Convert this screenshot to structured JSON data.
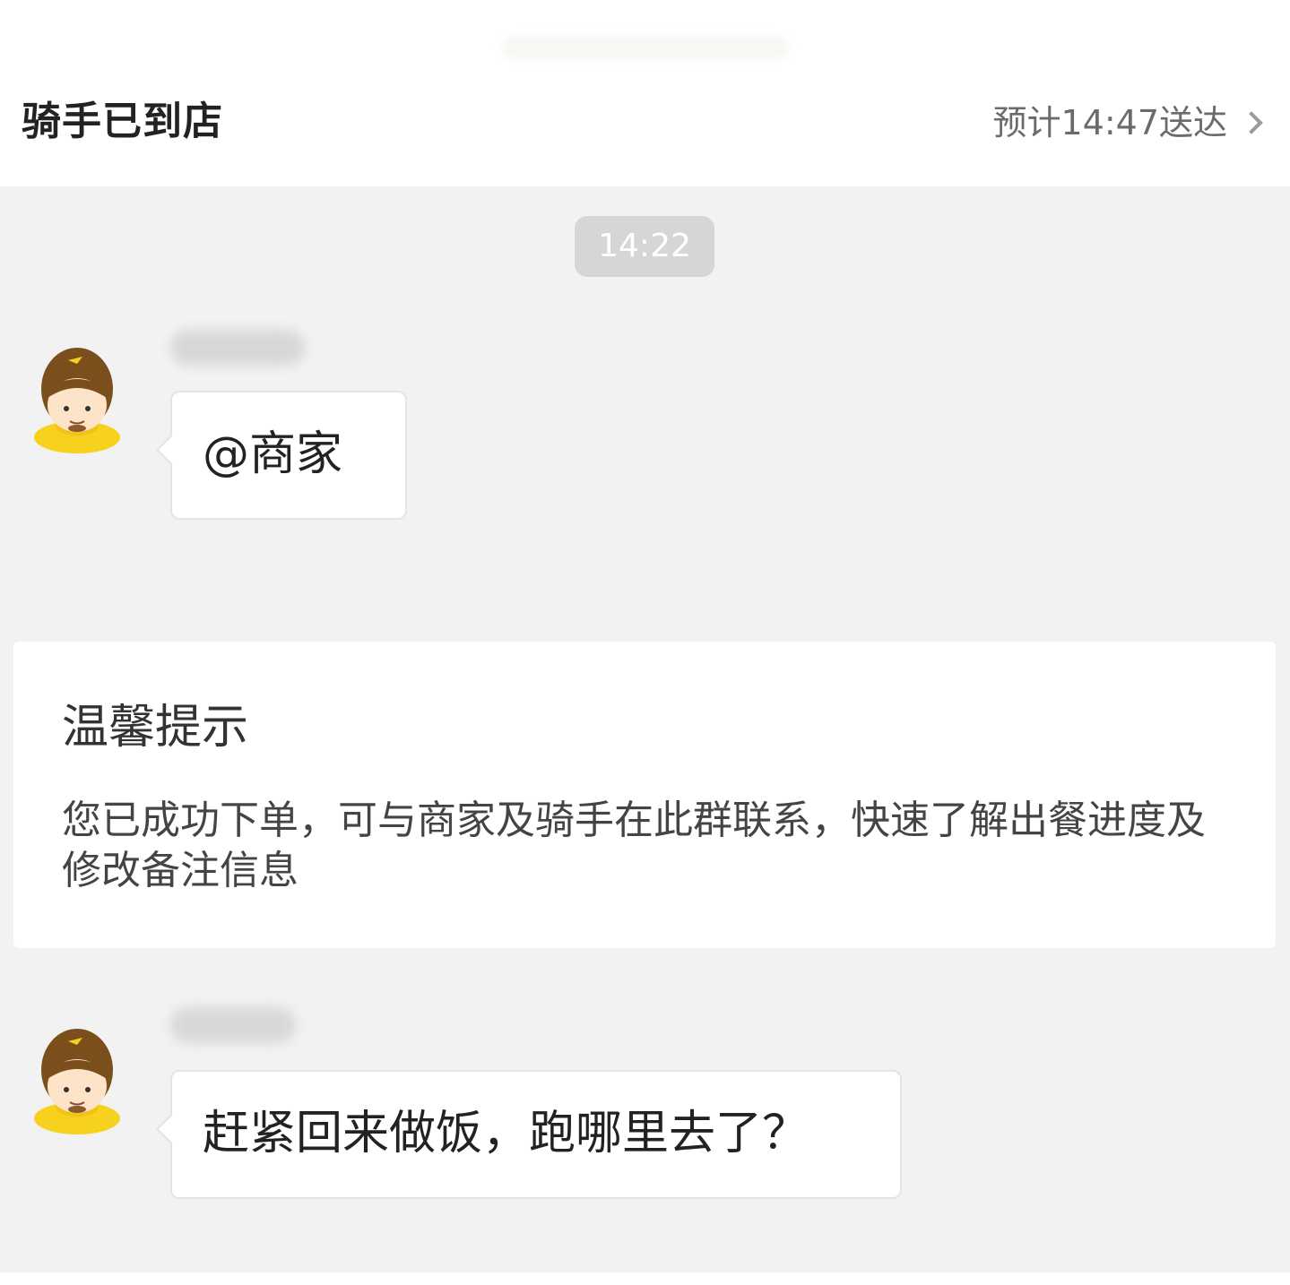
{
  "header": {
    "title": "骑手已到店",
    "eta_text": "预计14:47送达"
  },
  "chat": {
    "timestamp": "14:22",
    "messages": [
      {
        "sender": "rider",
        "text": "@商家"
      },
      {
        "sender": "rider",
        "text": "赶紧回来做饭，跑哪里去了？"
      }
    ],
    "tip": {
      "title": "温馨提示",
      "body": "您已成功下单，可与商家及骑手在此群联系，快速了解出餐进度及修改备注信息"
    }
  },
  "icons": {
    "avatar": "rider-avatar-icon",
    "chevron": "chevron-right-icon"
  },
  "colors": {
    "chat_background": "#f2f2f2",
    "bubble_background": "#ffffff",
    "timestamp_pill": "#d6d6d6",
    "avatar_helmet": "#7a4f1c",
    "avatar_collar": "#f6d21e"
  }
}
